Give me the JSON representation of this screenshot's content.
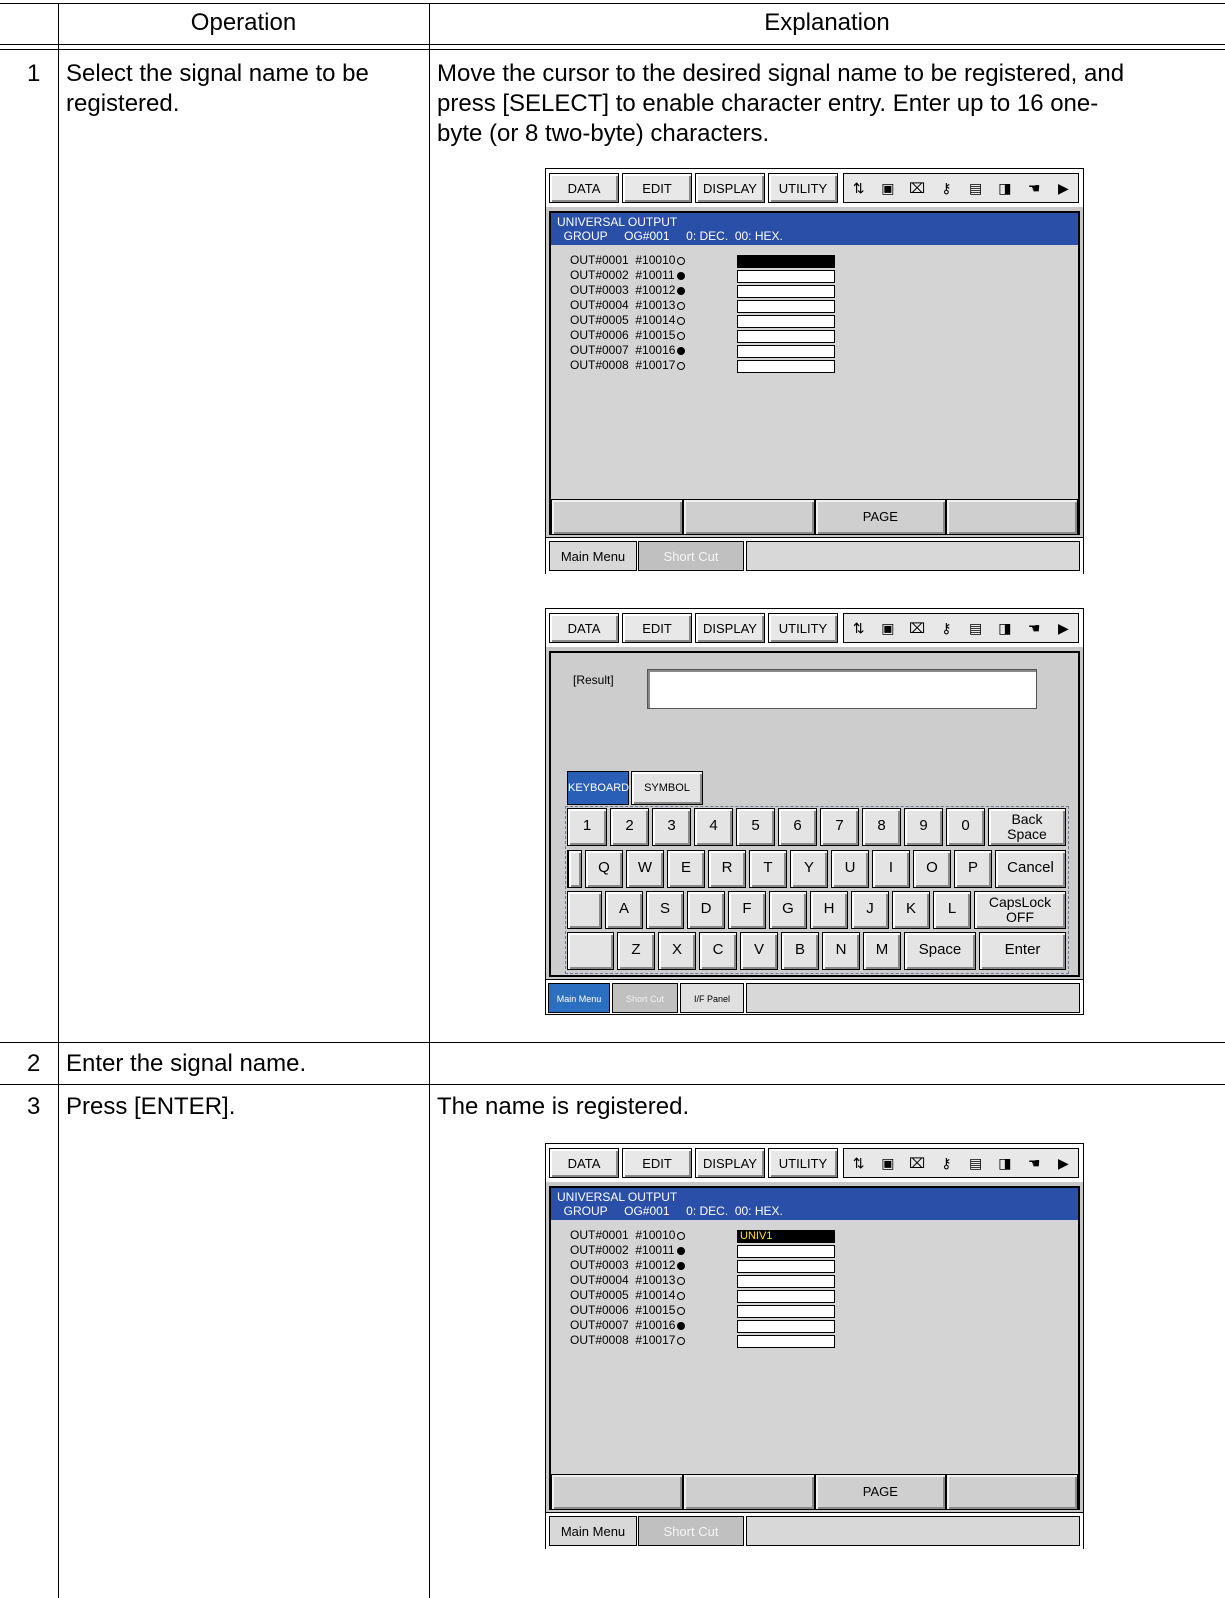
{
  "table": {
    "headers": [
      "Operation",
      "Explanation"
    ],
    "rows": [
      {
        "num": "1",
        "operation": "Select the signal name to be\nregistered.",
        "explanation": "Move the cursor to the desired signal name to be registered, and\npress [SELECT] to enable character entry.  Enter up to 16 one-\nbyte (or 8 two-byte) characters."
      },
      {
        "num": "2",
        "operation": "Enter the signal name.",
        "explanation": ""
      },
      {
        "num": "3",
        "operation": "Press [ENTER].",
        "explanation": "The name is registered."
      }
    ]
  },
  "pendant": {
    "menu": [
      "DATA",
      "EDIT",
      "DISPLAY",
      "UTILITY"
    ],
    "icons": [
      "robot-arm-icon",
      "step-icon",
      "job-icon",
      "key-icon",
      "monitor-icon",
      "export-icon",
      "hand-icon",
      "play-icon"
    ],
    "title": "UNIVERSAL OUTPUT",
    "group_line": "  GROUP     OG#001     0: DEC.  00: HEX.",
    "signals": [
      {
        "out": "OUT#0001",
        "addr": "#10010",
        "on": false
      },
      {
        "out": "OUT#0002",
        "addr": "#10011",
        "on": true
      },
      {
        "out": "OUT#0003",
        "addr": "#10012",
        "on": true
      },
      {
        "out": "OUT#0004",
        "addr": "#10013",
        "on": false
      },
      {
        "out": "OUT#0005",
        "addr": "#10014",
        "on": false
      },
      {
        "out": "OUT#0006",
        "addr": "#10015",
        "on": false
      },
      {
        "out": "OUT#0007",
        "addr": "#10016",
        "on": true
      },
      {
        "out": "OUT#0008",
        "addr": "#10017",
        "on": false
      }
    ],
    "fkeys": [
      "",
      "",
      "PAGE",
      ""
    ],
    "main_menu": "Main Menu",
    "short_cut": "Short Cut",
    "registered_name": "UNIV1"
  },
  "keyboard_screen": {
    "result_label": "[Result]",
    "tabs": [
      "KEYBOARD",
      "SYMBOL"
    ],
    "row1": [
      "1",
      "2",
      "3",
      "4",
      "5",
      "6",
      "7",
      "8",
      "9",
      "0"
    ],
    "backspace": "Back\nSpace",
    "row2": [
      "Q",
      "W",
      "E",
      "R",
      "T",
      "Y",
      "U",
      "I",
      "O",
      "P"
    ],
    "cancel": "Cancel",
    "row3": [
      "A",
      "S",
      "D",
      "F",
      "G",
      "H",
      "J",
      "K",
      "L"
    ],
    "capslock": "CapsLock\nOFF",
    "row4": [
      "Z",
      "X",
      "C",
      "V",
      "B",
      "N",
      "M"
    ],
    "space": "Space",
    "enter": "Enter",
    "bottom": [
      "Main Menu",
      "Short Cut",
      "I/F Panel"
    ]
  },
  "colors": {
    "accent": "#2a4fa8",
    "panel": "#c8c8c8",
    "highlight_text": "#ffe000"
  }
}
